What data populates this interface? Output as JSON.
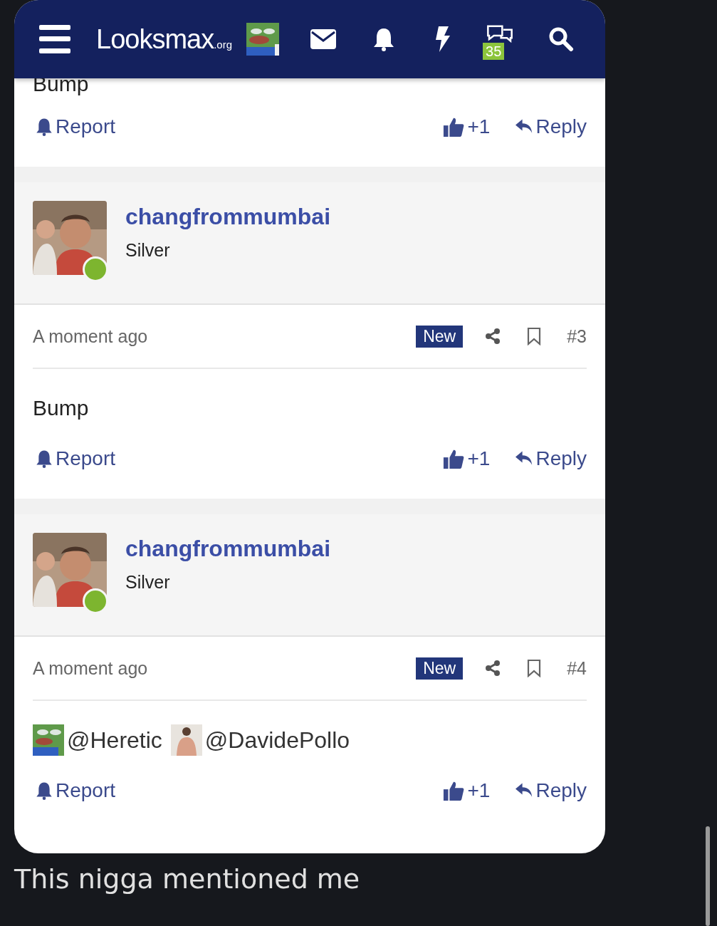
{
  "header": {
    "logo": "Looksmax",
    "logo_suffix": ".org",
    "conversations_badge": "35"
  },
  "top_post": {
    "body": [
      {
        "kind": "text",
        "text": "Bump"
      }
    ],
    "report": "Report",
    "likes": "+1",
    "reply": "Reply"
  },
  "posts": [
    {
      "author": "changfrommumbai",
      "rank": "Silver",
      "online": true,
      "time": "A moment ago",
      "new_label": "New",
      "number": "#3",
      "body": [
        {
          "kind": "text",
          "text": "Bump"
        }
      ],
      "report": "Report",
      "likes": "+1",
      "reply": "Reply"
    },
    {
      "author": "changfrommumbai",
      "rank": "Silver",
      "online": true,
      "time": "A moment ago",
      "new_label": "New",
      "number": "#4",
      "body": [
        {
          "kind": "mention",
          "text": "@Heretic"
        },
        {
          "kind": "mention",
          "text": "@DavidePollo"
        }
      ],
      "report": "Report",
      "likes": "+1",
      "reply": "Reply"
    }
  ],
  "caption": "This nigga mentioned me"
}
